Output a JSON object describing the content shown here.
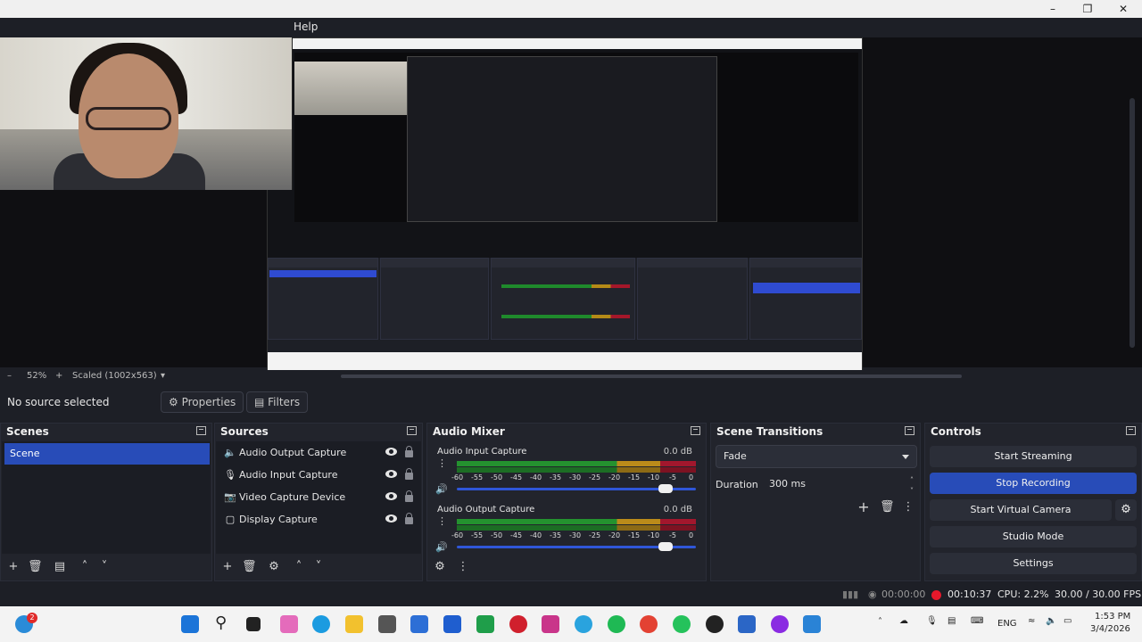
{
  "window": {
    "menu": [
      "Help"
    ],
    "controls": [
      "minimize",
      "restore",
      "close"
    ]
  },
  "preview": {
    "zoom": "52%",
    "scale_mode": "Scaled (1002x563)"
  },
  "context": {
    "no_source": "No source selected",
    "properties": "Properties",
    "filters": "Filters"
  },
  "scenes": {
    "title": "Scenes",
    "items": [
      "Scene"
    ]
  },
  "sources": {
    "title": "Sources",
    "items": [
      {
        "label": "Audio Output Capture",
        "icon": "speaker-icon"
      },
      {
        "label": "Audio Input Capture",
        "icon": "microphone-icon"
      },
      {
        "label": "Video Capture Device",
        "icon": "camera-icon"
      },
      {
        "label": "Display Capture",
        "icon": "monitor-icon"
      }
    ]
  },
  "mixer": {
    "title": "Audio Mixer",
    "ticks": [
      "-60",
      "-55",
      "-50",
      "-45",
      "-40",
      "-35",
      "-30",
      "-25",
      "-20",
      "-15",
      "-10",
      "-5",
      "0"
    ],
    "channels": [
      {
        "name": "Audio Input Capture",
        "db": "0.0 dB"
      },
      {
        "name": "Audio Output Capture",
        "db": "0.0 dB"
      }
    ]
  },
  "transitions": {
    "title": "Scene Transitions",
    "selected": "Fade",
    "duration_label": "Duration",
    "duration_value": "300 ms"
  },
  "controls": {
    "title": "Controls",
    "start_streaming": "Start Streaming",
    "stop_recording": "Stop Recording",
    "start_virtual_camera": "Start Virtual Camera",
    "studio_mode": "Studio Mode",
    "settings": "Settings"
  },
  "status": {
    "stream_time": "00:00:00",
    "rec_time": "00:10:37",
    "cpu": "CPU: 2.2%",
    "fps": "30.00 / 30.00 FPS"
  },
  "taskbar": {
    "badge": "2",
    "language": "ENG",
    "time": "1:53 PM",
    "date": "3/4/2026"
  },
  "colors": {
    "accent": "#284cb8",
    "record": "#e5182b",
    "panel": "#22242c"
  }
}
